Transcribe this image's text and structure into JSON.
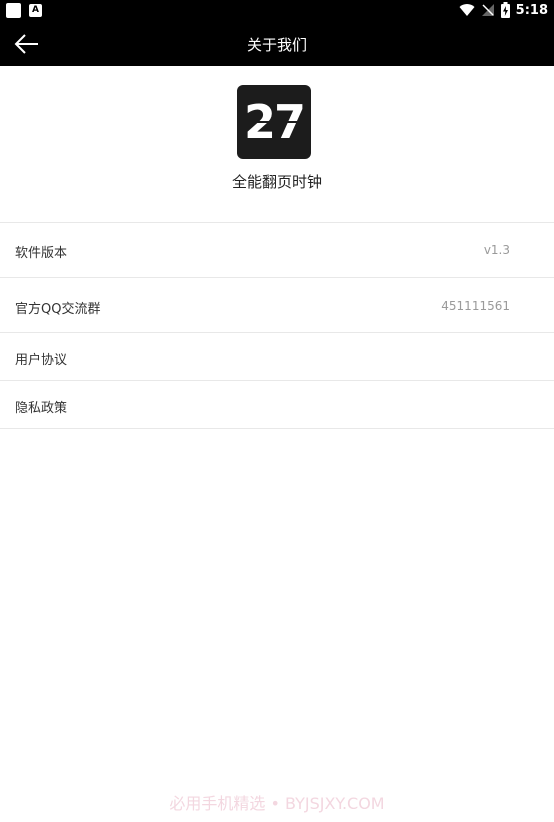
{
  "status_bar": {
    "time": "5:18",
    "notif_icon_1": "white-square-icon",
    "notif_icon_2": "a-badge-icon",
    "notif_badge_letter": "A",
    "wifi_icon": "wifi-icon",
    "signal_icon": "signal-off-icon",
    "battery_icon": "battery-charging-icon"
  },
  "app_bar": {
    "title": "关于我们",
    "back_icon": "arrow-left-icon"
  },
  "app_info": {
    "logo_text": "27",
    "name": "全能翻页时钟"
  },
  "rows": [
    {
      "label": "软件版本",
      "value": "v1.3"
    },
    {
      "label": "官方QQ交流群",
      "value": "451111561"
    },
    {
      "label": "用户协议",
      "value": ""
    },
    {
      "label": "隐私政策",
      "value": ""
    }
  ],
  "watermark": "必用手机精选 • BYJSJXY.COM",
  "colors": {
    "bar_background": "#000000",
    "page_background": "#ffffff",
    "divider": "#e8e8e8",
    "value_text": "#9a9a9a"
  }
}
